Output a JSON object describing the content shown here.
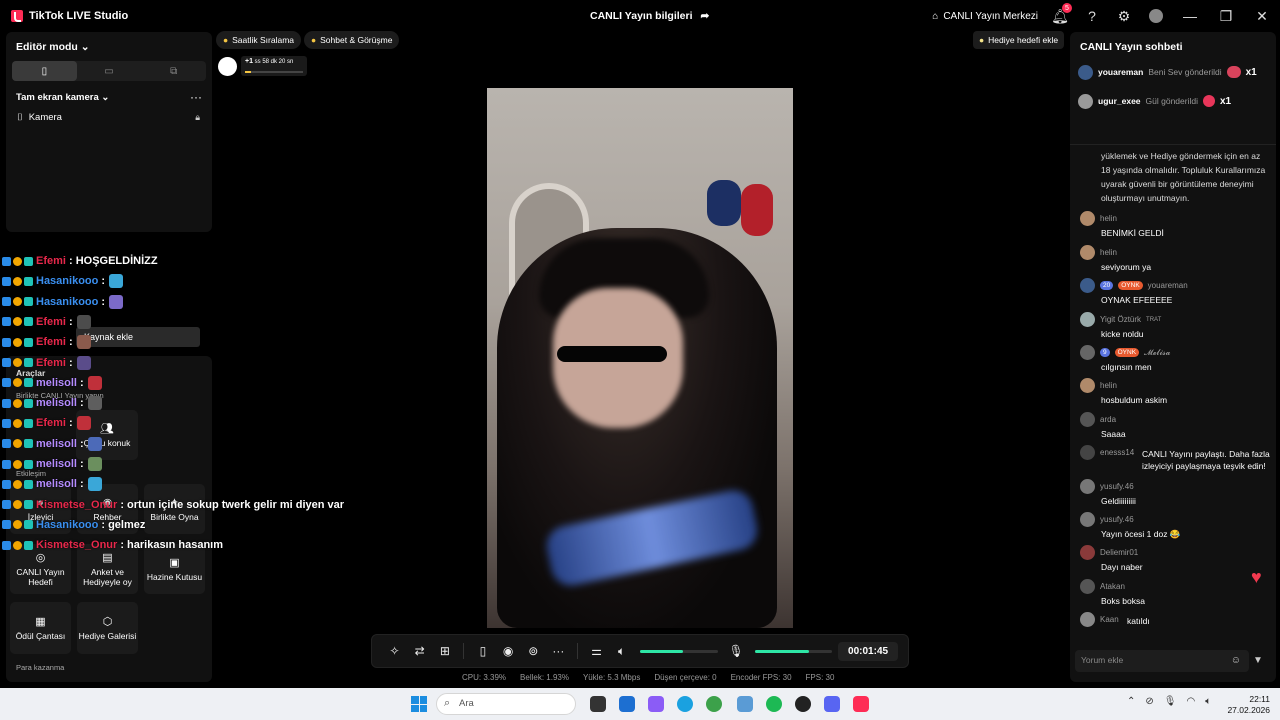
{
  "app": {
    "title": "TikTok LIVE Studio",
    "center_title": "CANLI Yayın bilgileri",
    "live_center": "CANLI Yayın Merkezi",
    "notif_count": "5"
  },
  "left": {
    "editor_mode": "Editör modu",
    "fullscreen_camera": "Tam ekran kamera",
    "camera": "Kamera",
    "add_source": "Kaynak ekle",
    "tools_label": "Araçlar",
    "collab_label": "Birlikte CANLI Yayın yapın",
    "multi_guest": "Çoklu konuk",
    "interaction_label": "Etkileşim",
    "viewer": "İzleyici",
    "guide": "Rehber",
    "play_together": "Birlikte Oyna",
    "live_goal": "CANLI Yayın Hedefi",
    "poll": "Anket ve Hediyeyle oy",
    "treasure": "Hazine Kutusu",
    "reward_bag": "Ödül Çantası",
    "gift_gallery": "Hediye Galerisi",
    "earn_label": "Para kazanma"
  },
  "overlay_chat": [
    {
      "name": "Efemi",
      "text": ": HOŞGELDİNİZZ",
      "color": "#e8284b"
    },
    {
      "name": "Hasanikooo",
      "text": ":",
      "color": "#3a8ff0"
    },
    {
      "name": "Hasanikooo",
      "text": ":",
      "color": "#3a8ff0"
    },
    {
      "name": "Efemi",
      "text": ":",
      "color": "#e8284b"
    },
    {
      "name": "Efemi",
      "text": ":",
      "color": "#e8284b"
    },
    {
      "name": "Efemi",
      "text": ":",
      "color": "#e8284b"
    },
    {
      "name": "melisoll",
      "text": ":",
      "color": "#b58cff"
    },
    {
      "name": "melisoll",
      "text": ":",
      "color": "#b58cff"
    },
    {
      "name": "Efemi",
      "text": ":",
      "color": "#e8284b"
    },
    {
      "name": "melisoll",
      "text": ":",
      "color": "#b58cff"
    },
    {
      "name": "melisoll",
      "text": ":",
      "color": "#b58cff"
    },
    {
      "name": "melisoll",
      "text": ":",
      "color": "#b58cff"
    },
    {
      "name": "Kismetse_Onur",
      "text": ": ortun içine sokup twerk gelir mi diyen var",
      "color": "#e8284b"
    },
    {
      "name": "Hasanikooo",
      "text": ": gelmez",
      "color": "#3a8ff0"
    },
    {
      "name": "Kismetse_Onur",
      "text": ": harikasın hasanım",
      "color": "#e8284b"
    }
  ],
  "center": {
    "chip_hourly": "Saatlik Sıralama",
    "chip_chat": "Sohbet & Görüşme",
    "mini_timer": "ss 58 dk 20 sn",
    "mini_plus": "+1",
    "gift_goal": "Hediye hedefi ekle",
    "timer": "00:01:45",
    "mic_level": 0.7,
    "vol_level": 0.55,
    "stats": {
      "cpu": "CPU: 3.39%",
      "mem": "Bellek: 1.93%",
      "upload": "Yükle: 5.3 Mbps",
      "dropped": "Düşen çerçeve: 0",
      "enc_fps": "Encoder FPS: 30",
      "fps": "FPS: 30"
    }
  },
  "right": {
    "title": "CANLI Yayın sohbeti",
    "gifts": [
      {
        "name": "youareman",
        "action": "Beni Sev gönderildi",
        "mult": "x1"
      },
      {
        "name": "ugur_exee",
        "action": "Gül gönderildi",
        "mult": "x1"
      }
    ],
    "notice": "yüklemek ve Hediye göndermek için en az 18 yaşında olmalıdır. Topluluk Kurallarımıza uyarak güvenli bir görüntüleme deneyimi oluşturmayı unutmayın.",
    "messages": [
      {
        "user": "helin",
        "text": "BENİMKİ GELDİ"
      },
      {
        "user": "helin",
        "text": "seviyorum ya"
      },
      {
        "user": "youareman",
        "text": "OYNAK EFEEEEE",
        "lvl": "20",
        "tag": "OYNK"
      },
      {
        "user": "Yigit Öztürk",
        "text": "kicke noldu",
        "suffix": "TRAT"
      },
      {
        "user": "𝓜𝓮𝓵𝓲𝓼𝓪",
        "text": "cılgınsın men",
        "lvl": "9",
        "tag": "OYNK"
      },
      {
        "user": "helin",
        "text": "hosbuldum askim"
      },
      {
        "user": "arda",
        "text": "Saaaa"
      },
      {
        "user": "enesss14",
        "text": "CANLI Yayını paylaştı. Daha fazla izleyiciyi paylaşmaya teşvik edin!"
      },
      {
        "user": "yusufy.46",
        "text": "Geldiiiiiiiii"
      },
      {
        "user": "yusufy.46",
        "text": "Yayın öcesi 1 doz 😂"
      },
      {
        "user": "Deliemir01",
        "text": "Dayı naber"
      },
      {
        "user": "Atakan",
        "text": "Boks boksa"
      },
      {
        "user": "Kaan",
        "text": "katıldı"
      }
    ],
    "comment_placeholder": "Yorum ekle"
  },
  "taskbar": {
    "search": "Ara",
    "time": "22:11",
    "date": "27.02.2026"
  }
}
